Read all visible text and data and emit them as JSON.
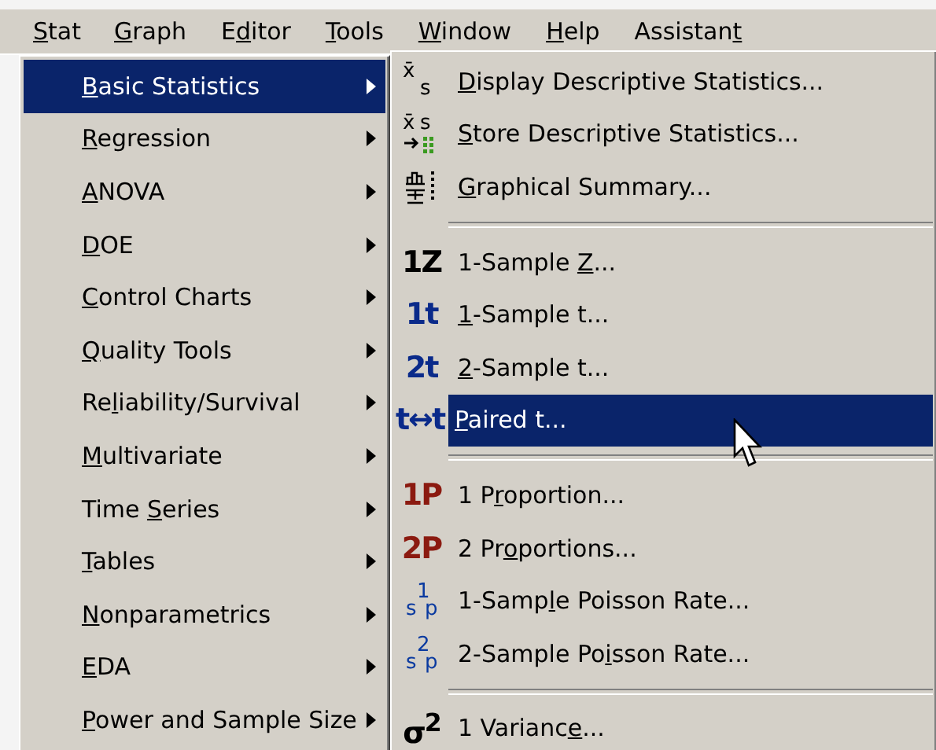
{
  "menu_bar": [
    {
      "label": {
        "key": "S",
        "after": "tat"
      },
      "selected": true
    },
    {
      "label": {
        "key": "G",
        "after": "raph"
      },
      "selected": false
    },
    {
      "label": {
        "before": "E",
        "key": "d",
        "after": "itor"
      },
      "selected": false
    },
    {
      "label": {
        "key": "T",
        "after": "ools"
      },
      "selected": false
    },
    {
      "label": {
        "key": "W",
        "after": "indow"
      },
      "selected": false
    },
    {
      "label": {
        "key": "H",
        "after": "elp"
      },
      "selected": false
    },
    {
      "label": {
        "before": "Assistan",
        "key": "t"
      },
      "selected": false
    }
  ],
  "stat_menu": [
    {
      "label": {
        "key": "B",
        "after": "asic Statistics"
      },
      "selected": true
    },
    {
      "label": {
        "key": "R",
        "after": "egression"
      },
      "selected": false
    },
    {
      "label": {
        "key": "A",
        "after": "NOVA"
      },
      "selected": false
    },
    {
      "label": {
        "key": "D",
        "after": "OE"
      },
      "selected": false
    },
    {
      "label": {
        "key": "C",
        "after": "ontrol Charts"
      },
      "selected": false
    },
    {
      "label": {
        "key": "Q",
        "after": "uality Tools"
      },
      "selected": false
    },
    {
      "label": {
        "before": "Re",
        "key": "l",
        "after": "iability/Survival"
      },
      "selected": false
    },
    {
      "label": {
        "key": "M",
        "after": "ultivariate"
      },
      "selected": false
    },
    {
      "label": {
        "before": "Time ",
        "key": "S",
        "after": "eries"
      },
      "selected": false
    },
    {
      "label": {
        "key": "T",
        "after": "ables"
      },
      "selected": false
    },
    {
      "label": {
        "key": "N",
        "after": "onparametrics"
      },
      "selected": false
    },
    {
      "label": {
        "key": "E",
        "after": "DA"
      },
      "selected": false
    },
    {
      "label": {
        "key": "P",
        "after": "ower and Sample Size"
      },
      "selected": false
    }
  ],
  "basic_statistics_menu": [
    {
      "kind": "item",
      "label": {
        "key": "D",
        "after": "isplay Descriptive Statistics..."
      },
      "selected": false,
      "icon": {
        "kind": "stat",
        "glyphs": [
          "x̄",
          "s"
        ]
      }
    },
    {
      "kind": "item",
      "label": {
        "key": "S",
        "after": "tore Descriptive Statistics..."
      },
      "selected": false,
      "icon": {
        "kind": "store",
        "glyphs": [
          "x̄",
          "s"
        ]
      }
    },
    {
      "kind": "item",
      "label": {
        "key": "G",
        "after": "raphical Summary..."
      },
      "selected": false,
      "icon": {
        "kind": "summary"
      }
    },
    {
      "kind": "separator"
    },
    {
      "kind": "item",
      "label": {
        "before": "1-Sample ",
        "key": "Z",
        "after": "..."
      },
      "selected": false,
      "icon": {
        "kind": "glyph",
        "text": "1Z",
        "color": "#000000"
      }
    },
    {
      "kind": "item",
      "label": {
        "key": "1",
        "after": "-Sample t..."
      },
      "selected": false,
      "icon": {
        "kind": "glyph",
        "text": "1t",
        "color": "#0a2a8a"
      }
    },
    {
      "kind": "item",
      "label": {
        "key": "2",
        "after": "-Sample t..."
      },
      "selected": false,
      "icon": {
        "kind": "glyph",
        "text": "2t",
        "color": "#0a2a8a"
      }
    },
    {
      "kind": "item",
      "label": {
        "key": "P",
        "after": "aired t..."
      },
      "selected": true,
      "icon": {
        "kind": "glyph",
        "text": "t↔t",
        "color": "#0a2a8a"
      }
    },
    {
      "kind": "separator"
    },
    {
      "kind": "item",
      "label": {
        "before": "1 P",
        "key": "r",
        "after": "oportion..."
      },
      "selected": false,
      "icon": {
        "kind": "glyph",
        "text": "1P",
        "color": "#8b1a10"
      }
    },
    {
      "kind": "item",
      "label": {
        "before": "2 Pr",
        "key": "o",
        "after": "portions..."
      },
      "selected": false,
      "icon": {
        "kind": "glyph",
        "text": "2P",
        "color": "#8b1a10"
      }
    },
    {
      "kind": "item",
      "label": {
        "before": "1-Samp",
        "key": "l",
        "after": "e Poisson Rate..."
      },
      "selected": false,
      "icon": {
        "kind": "poisson",
        "glyphs": [
          "1",
          "s",
          "p"
        ]
      }
    },
    {
      "kind": "item",
      "label": {
        "before": "2-Sample Po",
        "key": "i",
        "after": "sson Rate..."
      },
      "selected": false,
      "icon": {
        "kind": "poisson",
        "glyphs": [
          "2",
          "s",
          "p"
        ]
      }
    },
    {
      "kind": "separator"
    },
    {
      "kind": "item",
      "label": {
        "before": "1 Varianc",
        "key": "e",
        "after": "..."
      },
      "selected": false,
      "icon": {
        "kind": "glyph",
        "text": "σ$^{2}$",
        "color": "#000000"
      }
    }
  ]
}
